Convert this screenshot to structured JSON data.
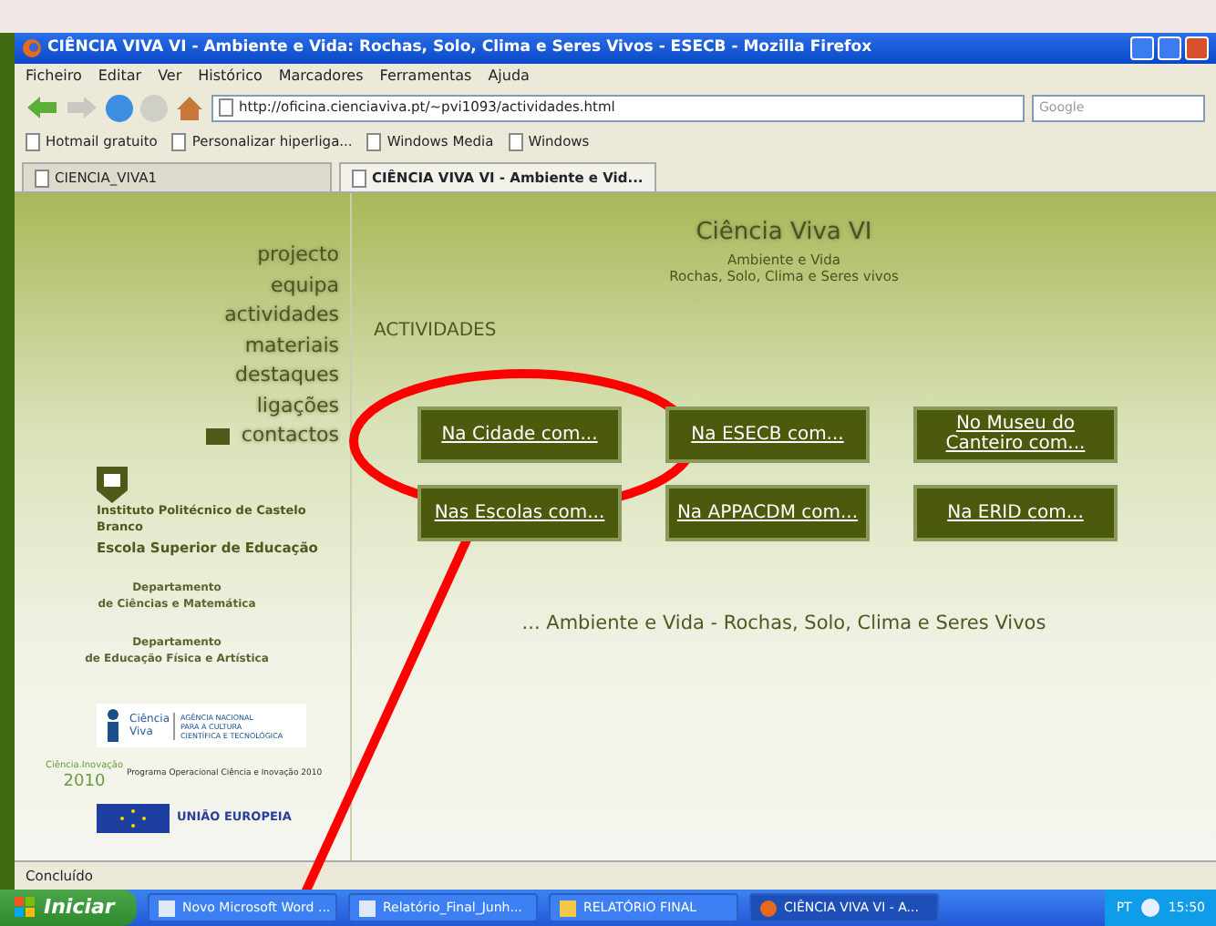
{
  "window": {
    "title": "CIÊNCIA VIVA VI - Ambiente e Vida: Rochas, Solo, Clima e Seres Vivos - ESECB - Mozilla Firefox"
  },
  "menu": [
    "Ficheiro",
    "Editar",
    "Ver",
    "Histórico",
    "Marcadores",
    "Ferramentas",
    "Ajuda"
  ],
  "address": {
    "value": "http://oficina.cienciaviva.pt/~pvi1093/actividades.html"
  },
  "search": {
    "placeholder": "Google"
  },
  "bookmarks": [
    "Hotmail gratuito",
    "Personalizar hiperliga...",
    "Windows Media",
    "Windows"
  ],
  "tabs": [
    {
      "label": "CIENCIA_VIVA1",
      "selected": false
    },
    {
      "label": "CIÊNCIA VIVA VI - Ambiente e Vid...",
      "selected": true
    }
  ],
  "page": {
    "nav": [
      {
        "label": "projecto",
        "kind": "link"
      },
      {
        "label": "equipa",
        "kind": "link"
      },
      {
        "label": "actividades",
        "kind": "link"
      },
      {
        "label": "materiais",
        "kind": "link"
      },
      {
        "label": "destaques",
        "kind": "link"
      },
      {
        "label": "ligações",
        "kind": "link"
      },
      {
        "label": "contactos",
        "kind": "mail"
      }
    ],
    "institute": "Instituto Politécnico de Castelo Branco",
    "school": "Escola Superior de Educação",
    "departments": [
      [
        "Departamento",
        "de Ciências e Matemática"
      ],
      [
        "Departamento",
        "de Educação Física e Artística"
      ]
    ],
    "logo_cv": {
      "name": [
        "Ciência",
        "Viva"
      ],
      "agency": [
        "AGÊNCIA NACIONAL",
        "PARA A CULTURA",
        "CIENTÍFICA E TECNOLÓGICA"
      ]
    },
    "logo_poci": {
      "name": "Ciência.Inovação",
      "year": "2010",
      "program": "Programa Operacional Ciência e Inovação 2010"
    },
    "logo_eu": "UNIÃO EUROPEIA",
    "title": "Ciência Viva VI",
    "subtitle": [
      "Ambiente e Vida",
      "Rochas, Solo, Clima e Seres vivos"
    ],
    "heading": "ACTIVIDADES",
    "buttons": [
      "Na Cidade com...",
      "Na ESECB com...",
      "No Museu do Canteiro com...",
      "Nas Escolas com...",
      "Na APPACDM com...",
      "Na ERID com..."
    ],
    "tagline": "... Ambiente e Vida - Rochas, Solo, Clima e Seres Vivos"
  },
  "status_bar": "Concluído",
  "taskbar": {
    "start": "Iniciar",
    "tasks": [
      {
        "label": "Novo Microsoft Word ...",
        "kind": "document",
        "selected": false
      },
      {
        "label": "Relatório_Final_Junh...",
        "kind": "document",
        "selected": false
      },
      {
        "label": "RELATÓRIO FINAL",
        "kind": "folder",
        "selected": false
      },
      {
        "label": "CIÊNCIA VIVA VI - A...",
        "kind": "browser",
        "selected": true
      }
    ],
    "language": "PT",
    "clock": "15:50"
  }
}
